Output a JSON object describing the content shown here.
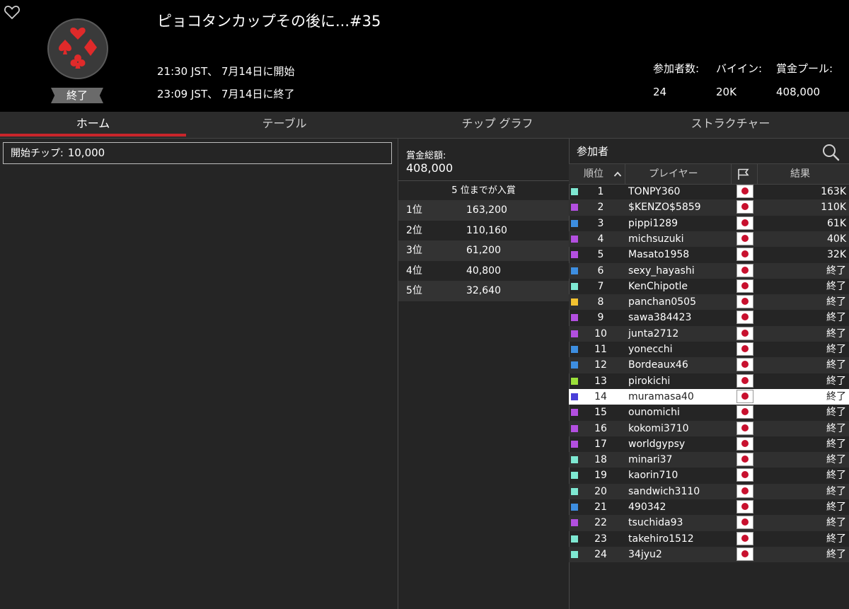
{
  "header": {
    "title": "ピョコタンカップその後に...#35",
    "start_time": "21:30 JST、 7月14日に開始",
    "end_time": "23:09 JST、 7月14日に終了",
    "status": "終了",
    "stats": {
      "entrants_label": "参加者数:",
      "entrants_value": "24",
      "buyin_label": "バイイン:",
      "buyin_value": "20K",
      "pool_label": "賞金プール:",
      "pool_value": "408,000"
    }
  },
  "tabs": [
    {
      "label": "ホーム",
      "active": true
    },
    {
      "label": "テーブル",
      "active": false
    },
    {
      "label": "チップ グラフ",
      "active": false
    },
    {
      "label": "ストラクチャー",
      "active": false
    }
  ],
  "home": {
    "starting_chips_label": "開始チップ:",
    "starting_chips_value": "10,000"
  },
  "prizes": {
    "total_label": "賞金総額:",
    "total_value": "408,000",
    "paid_places_text": "5 位までが入賞",
    "payouts": [
      {
        "place": "1位",
        "amount": "163,200"
      },
      {
        "place": "2位",
        "amount": "110,160"
      },
      {
        "place": "3位",
        "amount": "61,200"
      },
      {
        "place": "4位",
        "amount": "40,800"
      },
      {
        "place": "5位",
        "amount": "32,640"
      }
    ]
  },
  "players": {
    "title": "参加者",
    "columns": {
      "rank": "順位",
      "player": "プレイヤー",
      "result": "結果"
    },
    "highlight_rank": 14,
    "rows": [
      {
        "rank": "1",
        "name": "TONPY360",
        "result": "163K",
        "color": "#7ee8d2"
      },
      {
        "rank": "2",
        "name": "$KENZO$5859",
        "result": "110K",
        "color": "#b34fe0"
      },
      {
        "rank": "3",
        "name": "pippi1289",
        "result": "61K",
        "color": "#3d8ee0"
      },
      {
        "rank": "4",
        "name": "michsuzuki",
        "result": "40K",
        "color": "#b34fe0"
      },
      {
        "rank": "5",
        "name": "Masato1958",
        "result": "32K",
        "color": "#b34fe0"
      },
      {
        "rank": "6",
        "name": "sexy_hayashi",
        "result": "終了",
        "color": "#3d8ee0"
      },
      {
        "rank": "7",
        "name": "KenChipotle",
        "result": "終了",
        "color": "#7ee8d2"
      },
      {
        "rank": "8",
        "name": "panchan0505",
        "result": "終了",
        "color": "#f2c230"
      },
      {
        "rank": "9",
        "name": "sawa384423",
        "result": "終了",
        "color": "#b34fe0"
      },
      {
        "rank": "10",
        "name": "junta2712",
        "result": "終了",
        "color": "#b34fe0"
      },
      {
        "rank": "11",
        "name": "yonecchi",
        "result": "終了",
        "color": "#3d8ee0"
      },
      {
        "rank": "12",
        "name": "Bordeaux46",
        "result": "終了",
        "color": "#3d8ee0"
      },
      {
        "rank": "13",
        "name": "pirokichi",
        "result": "終了",
        "color": "#9be03a"
      },
      {
        "rank": "14",
        "name": "muramasa40",
        "result": "終了",
        "color": "#4a3fd8"
      },
      {
        "rank": "15",
        "name": "ounomichi",
        "result": "終了",
        "color": "#b34fe0"
      },
      {
        "rank": "16",
        "name": "kokomi3710",
        "result": "終了",
        "color": "#b34fe0"
      },
      {
        "rank": "17",
        "name": "worldgypsy",
        "result": "終了",
        "color": "#b34fe0"
      },
      {
        "rank": "18",
        "name": "minari37",
        "result": "終了",
        "color": "#7ee8d2"
      },
      {
        "rank": "19",
        "name": "kaorin710",
        "result": "終了",
        "color": "#7ee8d2"
      },
      {
        "rank": "20",
        "name": "sandwich3110",
        "result": "終了",
        "color": "#7ee8d2"
      },
      {
        "rank": "21",
        "name": "490342",
        "result": "終了",
        "color": "#3d8ee0"
      },
      {
        "rank": "22",
        "name": "tsuchida93",
        "result": "終了",
        "color": "#b34fe0"
      },
      {
        "rank": "23",
        "name": "takehiro1512",
        "result": "終了",
        "color": "#7ee8d2"
      },
      {
        "rank": "24",
        "name": "34jyu2",
        "result": "終了",
        "color": "#7ee8d2"
      }
    ]
  },
  "icons": {
    "favorite": "heart-outline-icon",
    "logo": "card-suits-logo",
    "search": "search-icon",
    "sort": "chevron-up-icon",
    "country_column": "flag-icon",
    "country": "japan-flag-icon"
  },
  "colors": {
    "accent": "#c9252b",
    "background": "#252525",
    "header_background": "#000000",
    "highlight_row": "#ffffff"
  }
}
